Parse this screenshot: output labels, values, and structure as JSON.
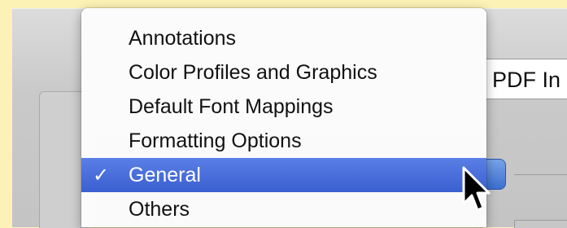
{
  "background_field_text": "PDF In",
  "menu": {
    "items": [
      {
        "label": "Annotations",
        "checked": false
      },
      {
        "label": "Color Profiles and Graphics",
        "checked": false
      },
      {
        "label": "Default Font Mappings",
        "checked": false
      },
      {
        "label": "Formatting Options",
        "checked": false
      },
      {
        "label": "General",
        "checked": true
      },
      {
        "label": "Others",
        "checked": false
      }
    ],
    "check_glyph": "✓",
    "selected_color": "#3f63d4"
  },
  "icons": [
    "checkmark-icon",
    "arrow-cursor-icon"
  ]
}
